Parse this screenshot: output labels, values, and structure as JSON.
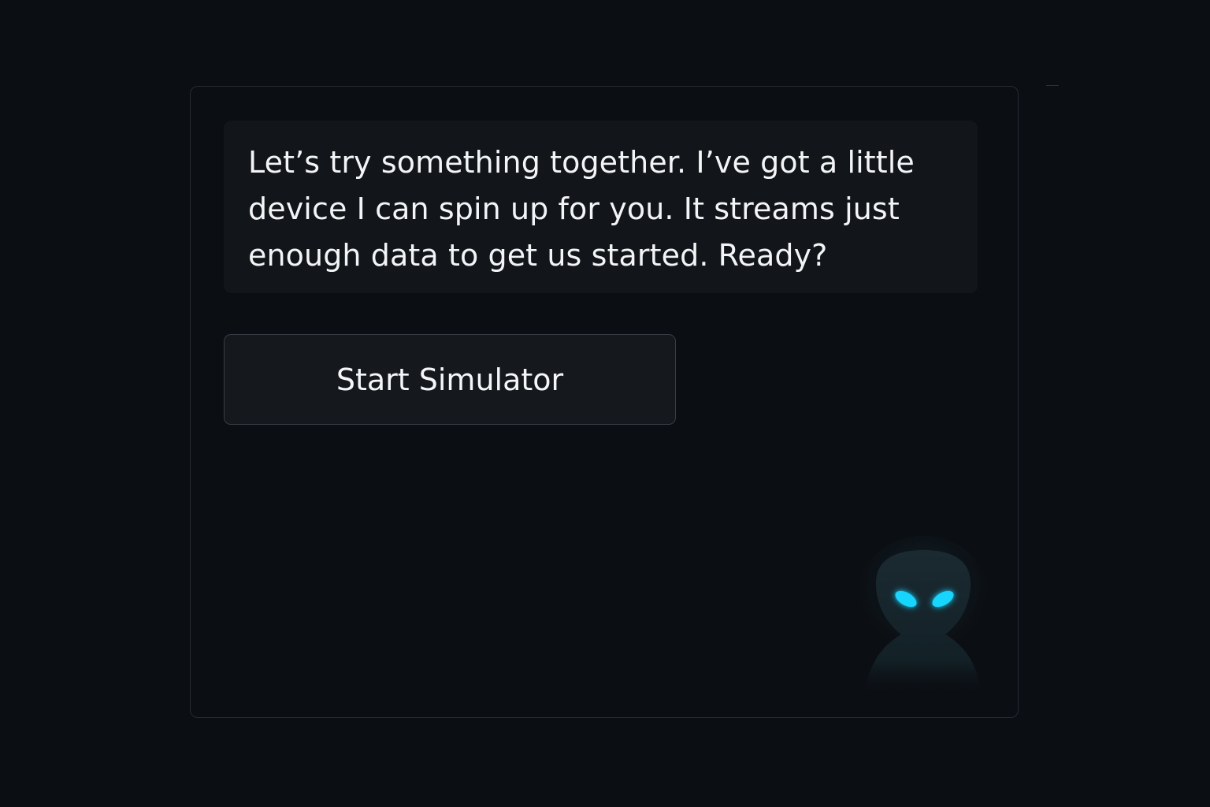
{
  "message": {
    "text": "Let’s try something together. I’ve got a little device I can spin up for you. It streams just enough data to get us started. Ready?"
  },
  "actions": {
    "start_label": "Start Simulator"
  },
  "mascot": {
    "icon": "alien-icon",
    "eye_color": "#19d6ff",
    "body_color": "#1b2a31"
  }
}
